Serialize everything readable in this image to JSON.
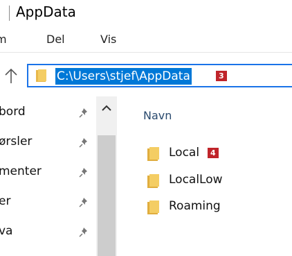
{
  "window": {
    "title": "AppData"
  },
  "ribbon": {
    "tabs": [
      {
        "label": "m"
      },
      {
        "label": "Del"
      },
      {
        "label": "Vis"
      }
    ]
  },
  "address": {
    "path": "C:\\Users\\stjef\\AppData",
    "badge": "3"
  },
  "nav": {
    "items": [
      {
        "label": "bord"
      },
      {
        "label": "ørsler"
      },
      {
        "label": "menter"
      },
      {
        "label": "er"
      },
      {
        "label": "va"
      }
    ]
  },
  "content": {
    "column_header": "Navn",
    "files": [
      {
        "name": "Local",
        "badge": "4"
      },
      {
        "name": "LocalLow"
      },
      {
        "name": "Roaming"
      }
    ]
  },
  "colors": {
    "accent": "#0078d7",
    "badge": "#c0242a",
    "folder": "#e8b84a"
  }
}
